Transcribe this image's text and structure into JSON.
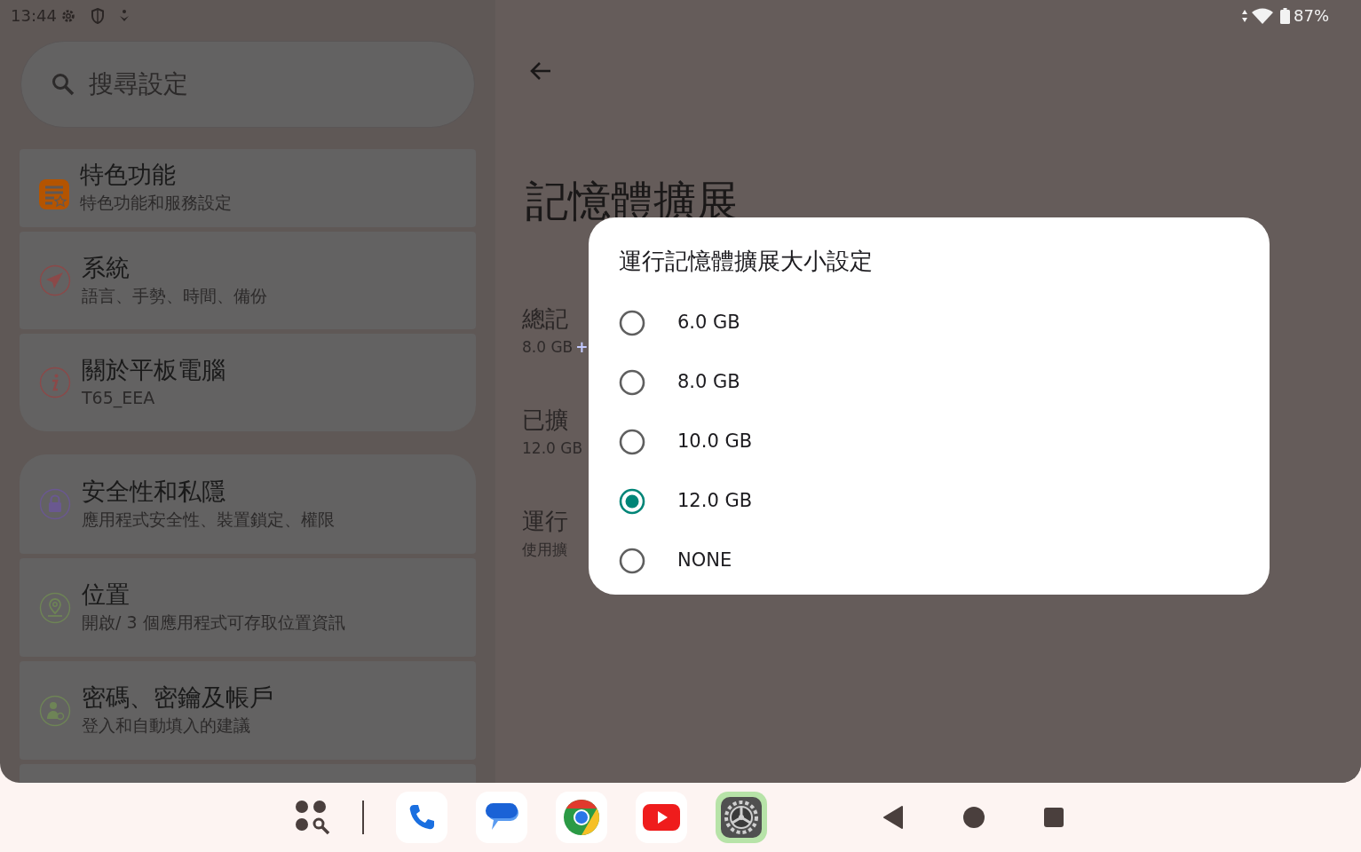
{
  "status_bar": {
    "time": "13:44",
    "battery": "87%"
  },
  "search": {
    "placeholder": "搜尋設定"
  },
  "settings_items": [
    {
      "kind": "features",
      "title": "特色功能",
      "subtitle": "特色功能和服務設定"
    },
    {
      "kind": "system",
      "title": "系統",
      "subtitle": "語言、手勢、時間、備份"
    },
    {
      "kind": "about",
      "title": "關於平板電腦",
      "subtitle": "T65_EEA"
    },
    {
      "kind": "security",
      "title": "安全性和私隱",
      "subtitle": "應用程式安全性、裝置鎖定、權限"
    },
    {
      "kind": "location",
      "title": "位置",
      "subtitle": "開啟/ 3 個應用程式可存取位置資訊"
    },
    {
      "kind": "accounts",
      "title": "密碼、密鑰及帳戶",
      "subtitle": "登入和自動填入的建議"
    }
  ],
  "detail": {
    "title": "記憶體擴展",
    "rows": [
      {
        "label": "總記",
        "value": "8.0 GB",
        "extra": "+"
      },
      {
        "label": "已擴",
        "value": "12.0 GB"
      },
      {
        "label": "運行",
        "value": "使用擴"
      }
    ]
  },
  "dialog": {
    "title": "運行記憶體擴展大小設定",
    "options": [
      {
        "label": "6.0 GB",
        "selected": false
      },
      {
        "label": "8.0 GB",
        "selected": false
      },
      {
        "label": "10.0 GB",
        "selected": false
      },
      {
        "label": "12.0 GB",
        "selected": true
      },
      {
        "label": "NONE",
        "selected": false
      }
    ]
  },
  "taskbar": {
    "apps": [
      {
        "kind": "phone",
        "selected": false
      },
      {
        "kind": "messages",
        "selected": false
      },
      {
        "kind": "browser",
        "selected": false
      },
      {
        "kind": "video",
        "selected": false
      },
      {
        "kind": "settings",
        "selected": true
      }
    ]
  }
}
